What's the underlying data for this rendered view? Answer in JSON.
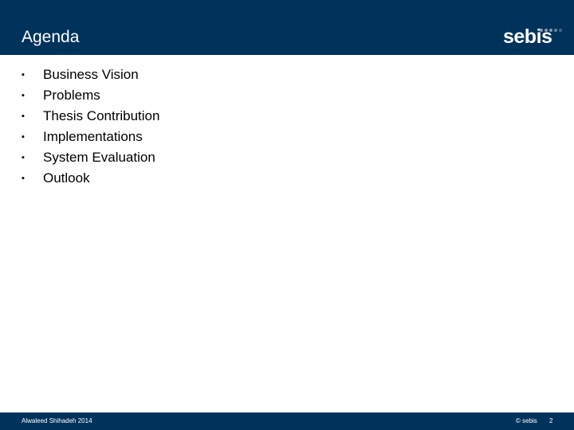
{
  "header": {
    "title": "Agenda",
    "logo_text": "sebis",
    "logo_dot_colors": [
      "#8a9bb3",
      "#8a9bb3",
      "#8a9bb3",
      "#6c7f99",
      "#4d6482"
    ],
    "background_color": "#00335c"
  },
  "agenda": {
    "bullet_glyph": "▪",
    "items": [
      {
        "label": "Business Vision"
      },
      {
        "label": "Problems"
      },
      {
        "label": "Thesis Contribution"
      },
      {
        "label": "Implementations"
      },
      {
        "label": "System Evaluation"
      },
      {
        "label": "Outlook"
      }
    ]
  },
  "footer": {
    "author": "Alwaleed Shihadeh 2014",
    "copyright": "© sebis",
    "page_number": "2"
  }
}
